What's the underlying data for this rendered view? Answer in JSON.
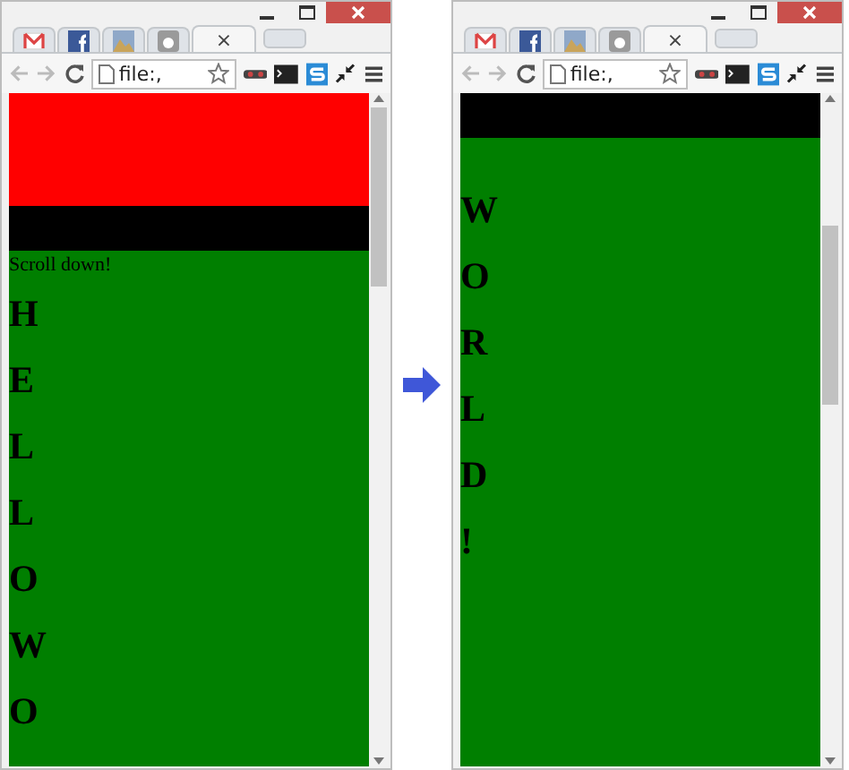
{
  "windows": [
    {
      "tabs": [
        {
          "kind": "mail",
          "selected": false
        },
        {
          "kind": "blue",
          "selected": false
        },
        {
          "kind": "image",
          "selected": false
        },
        {
          "kind": "grey",
          "selected": false
        },
        {
          "kind": "blank",
          "selected": true,
          "close": "×"
        }
      ],
      "address": "file:,",
      "banner": true,
      "caption": "Scroll down!",
      "letters": [
        "H",
        "E",
        "L",
        "L",
        "O",
        "W",
        "O"
      ]
    },
    {
      "tabs": [
        {
          "kind": "mail",
          "selected": false
        },
        {
          "kind": "blue",
          "selected": false
        },
        {
          "kind": "image",
          "selected": false
        },
        {
          "kind": "grey",
          "selected": false
        },
        {
          "kind": "blank",
          "selected": true,
          "close": "×"
        }
      ],
      "address": "file:,",
      "banner": false,
      "letters": [
        "W",
        "O",
        "R",
        "L",
        "D",
        "!"
      ]
    }
  ]
}
